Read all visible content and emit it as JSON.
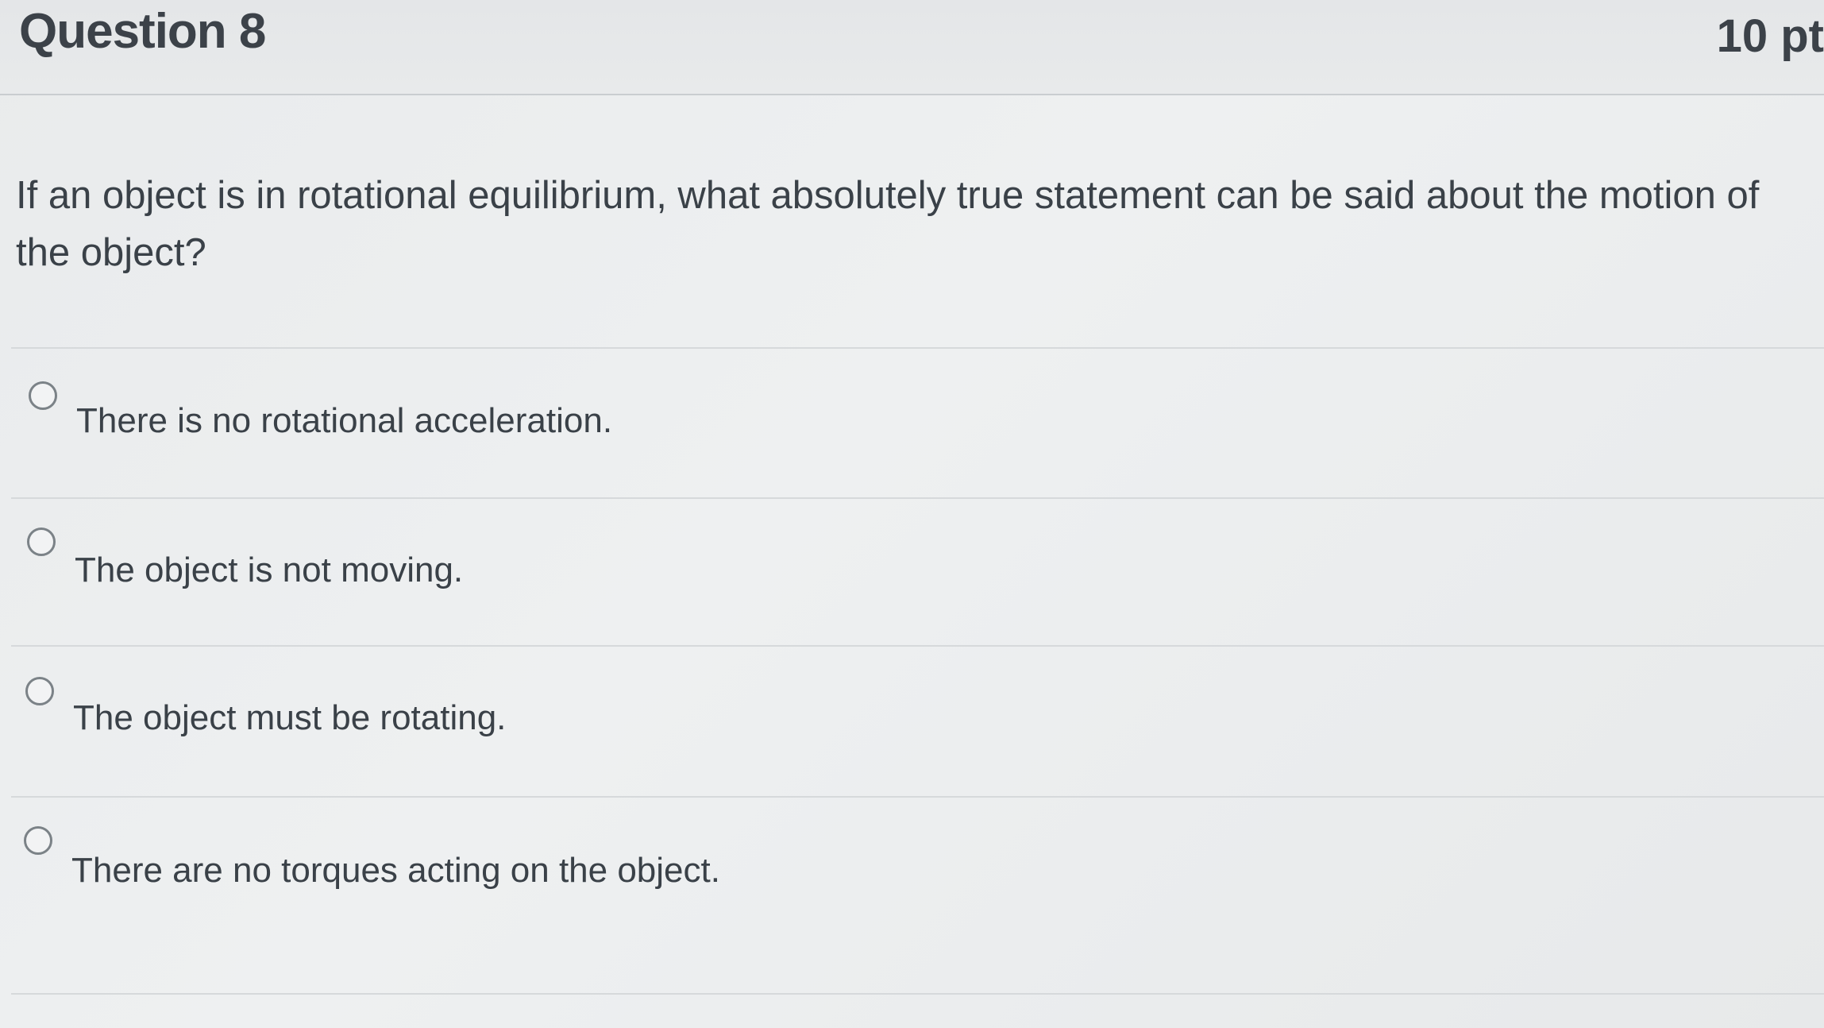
{
  "header": {
    "question_title": "Question 8",
    "points": "10 pt"
  },
  "question": {
    "text": "If an object is in rotational equilibrium, what absolutely true statement can be said about the motion of the object?"
  },
  "options": [
    {
      "label": "There is no rotational acceleration.",
      "selected": false
    },
    {
      "label": "The object is not moving.",
      "selected": false
    },
    {
      "label": "The object must be rotating.",
      "selected": false
    },
    {
      "label": "There are no torques acting on the object.",
      "selected": false
    }
  ]
}
